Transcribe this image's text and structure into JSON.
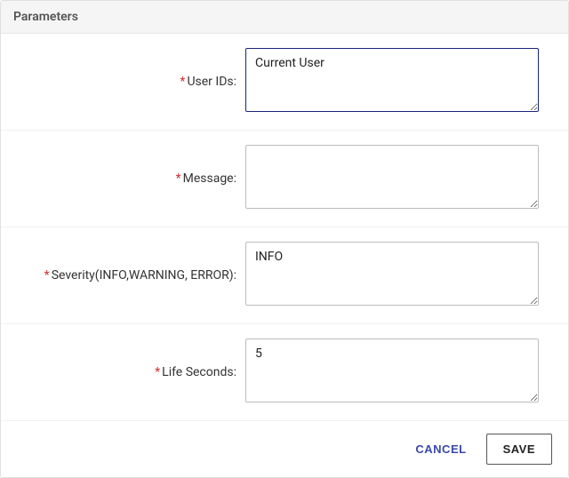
{
  "header": {
    "title": "Parameters"
  },
  "fields": {
    "user_ids": {
      "label": "User IDs:",
      "value": "Current User"
    },
    "message": {
      "label": "Message:",
      "value": ""
    },
    "severity": {
      "label": "Severity(INFO,WARNING, ERROR):",
      "value": "INFO"
    },
    "life_seconds": {
      "label": "Life Seconds:",
      "value": "5"
    }
  },
  "actions": {
    "cancel": "CANCEL",
    "save": "SAVE"
  },
  "required_marker": "*"
}
